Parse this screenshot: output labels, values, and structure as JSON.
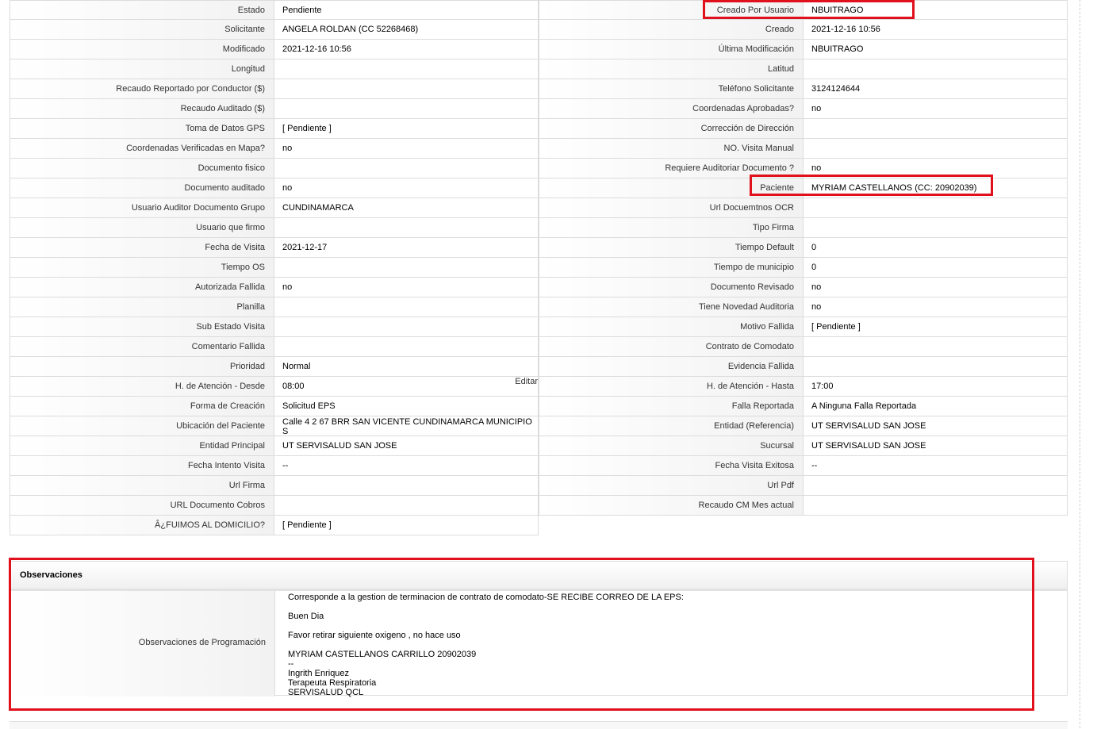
{
  "rows": [
    {
      "l1": "Estado",
      "v1": "Pendiente",
      "l2": "Creado Por Usuario",
      "v2": "NBUITRAGO"
    },
    {
      "l1": "Solicitante",
      "v1": "ANGELA ROLDAN (CC 52268468)",
      "l2": "Creado",
      "v2": "2021-12-16 10:56"
    },
    {
      "l1": "Modificado",
      "v1": "2021-12-16 10:56",
      "l2": "Última Modificación",
      "v2": " NBUITRAGO"
    },
    {
      "l1": "Longitud",
      "v1": "",
      "l2": "Latitud",
      "v2": ""
    },
    {
      "l1": "Recaudo Reportado por Conductor ($)",
      "v1": "",
      "l2": "Teléfono Solicitante",
      "v2": "3124124644"
    },
    {
      "l1": "Recaudo Auditado ($)",
      "v1": "",
      "l2": "Coordenadas Aprobadas?",
      "v2": " no"
    },
    {
      "l1": "Toma de Datos GPS",
      "v1": "[ Pendiente ]",
      "l2": "Corrección de Dirección",
      "v2": ""
    },
    {
      "l1": "Coordenadas Verificadas en Mapa?",
      "v1": " no",
      "l2": "NO. Visita Manual",
      "v2": ""
    },
    {
      "l1": "Documento fisico",
      "v1": "",
      "l2": "Requiere Auditoriar Documento ?",
      "v2": " no"
    },
    {
      "l1": "Documento auditado",
      "v1": " no",
      "l2": "Paciente",
      "v2": "MYRIAM CASTELLANOS (CC: 20902039)"
    },
    {
      "l1": "Usuario Auditor Documento Grupo",
      "v1": "CUNDINAMARCA",
      "l2": "Url Docuemtnos OCR",
      "v2": ""
    },
    {
      "l1": "Usuario que firmo",
      "v1": "",
      "l2": "Tipo Firma",
      "v2": ""
    },
    {
      "l1": "Fecha de Visita",
      "v1": " 2021-12-17",
      "l2": "Tiempo Default",
      "v2": "0"
    },
    {
      "l1": "Tiempo OS",
      "v1": "",
      "l2": "Tiempo de municipio",
      "v2": "0"
    },
    {
      "l1": "Autorizada Fallida",
      "v1": " no",
      "l2": "Documento Revisado",
      "v2": " no"
    },
    {
      "l1": "Planilla",
      "v1": "",
      "l2": "Tiene Novedad Auditoria",
      "v2": " no"
    },
    {
      "l1": "Sub Estado Visita",
      "v1": "",
      "l2": "Motivo Fallida",
      "v2": "[ Pendiente ]"
    },
    {
      "l1": "Comentario Fallida",
      "v1": "",
      "l2": "Contrato de Comodato",
      "v2": ""
    },
    {
      "l1": "Prioridad",
      "v1": "Normal",
      "l2": "Evidencia Fallida",
      "v2": ""
    },
    {
      "l1": "H. de Atención - Desde",
      "v1": "08:00",
      "l2": "H. de Atención - Hasta",
      "v2": "17:00"
    },
    {
      "l1": "Forma de Creación",
      "v1": "Solicitud EPS",
      "l2": "Falla Reportada",
      "v2": "A Ninguna Falla Reportada"
    },
    {
      "l1": "Ubicación del Paciente",
      "v1": "Calle 4 2 67 BRR SAN VICENTE CUNDINAMARCA MUNICIPIO S",
      "l2": "Entidad (Referencia)",
      "v2": "UT SERVISALUD SAN JOSE"
    },
    {
      "l1": "Entidad Principal",
      "v1": "UT SERVISALUD SAN JOSE",
      "l2": "Sucursal",
      "v2": "UT SERVISALUD SAN JOSE"
    },
    {
      "l1": "Fecha Intento Visita",
      "v1": " --",
      "l2": "Fecha Visita Exitosa",
      "v2": " --"
    },
    {
      "l1": "Url Firma",
      "v1": "",
      "l2": "Url Pdf",
      "v2": ""
    },
    {
      "l1": "URL Documento Cobros",
      "v1": "",
      "l2": "Recaudo CM Mes actual",
      "v2": ""
    },
    {
      "l1": "Â¿FUIMOS AL DOMICILIO?",
      "v1": "[ Pendiente ]",
      "l2": null,
      "v2": null
    }
  ],
  "edit_link": "Editar",
  "observaciones": {
    "title": "Observaciones",
    "label": "Observaciones de Programación",
    "lines": [
      "Corresponde a la gestion de terminacion de contrato de comodato-SE RECIBE CORREO DE LA EPS:",
      "",
      "Buen Dia",
      "",
      "Favor retirar siguiente oxigeno , no hace uso",
      "",
      "MYRIAM CASTELLANOS CARRILLO 20902039",
      "--",
      "Ingrith Enriquez",
      "Terapeuta Respiratoria",
      "SERVISALUD QCL"
    ]
  },
  "highlight_color": "#e0101c"
}
